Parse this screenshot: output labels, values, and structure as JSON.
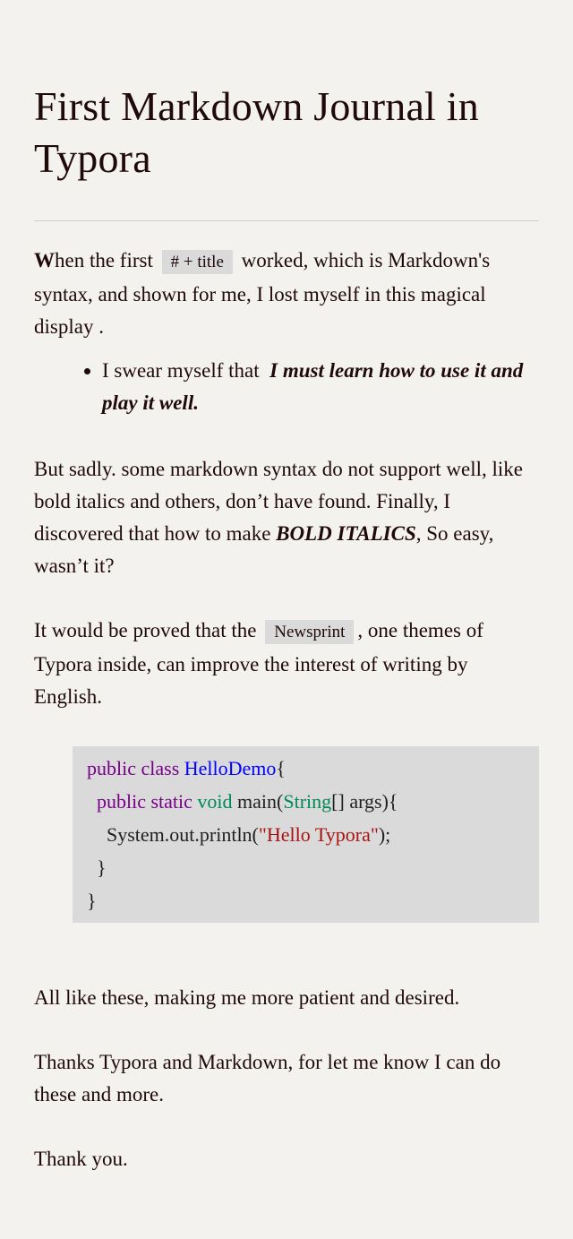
{
  "title": "First Markdown Journal in Typora",
  "para1": {
    "first_letter": "W",
    "before_code": "hen the first",
    "code": "# + title",
    "after_code": "worked, which is Markdown's syntax, and shown for me, I lost myself in this magical display ."
  },
  "bullet": {
    "text": "I swear myself that",
    "emphasis": "I must learn how to use it and play it well."
  },
  "para2": {
    "before": "But sadly. some markdown syntax do not support well, like bold italics and others, don’t have found. Finally, I discovered that how to make",
    "emphasis": "BOLD ITALICS",
    "after": ", So easy, wasn’t it?"
  },
  "para3": {
    "before": "It would be proved that the",
    "code": "Newsprint",
    "after": ", one themes of Typora inside, can improve the interest of writing by English."
  },
  "code_block": {
    "line1": {
      "kw": "public class",
      "name": "HelloDemo",
      "rest": "{"
    },
    "line2": {
      "indent": "  ",
      "kw": "public static",
      "type1": "void",
      "mid": "main(",
      "type2": "String",
      "rest": "[] args){"
    },
    "line3": {
      "indent": "    ",
      "pre": "System.out.println(",
      "str": "\"Hello Typora\"",
      "rest": ");"
    },
    "line4": "  }",
    "line5": "}"
  },
  "para4": "All like these, making me more patient and desired.",
  "para5": "Thanks Typora and Markdown, for let me know I can do these and more.",
  "para6": "Thank you.",
  "colors": {
    "background": "#f3f2ee",
    "text": "#1f0909",
    "code_bg": "#dadada",
    "keyword": "#770088",
    "definition": "#0000ff",
    "type": "#008855",
    "string": "#aa1111"
  }
}
